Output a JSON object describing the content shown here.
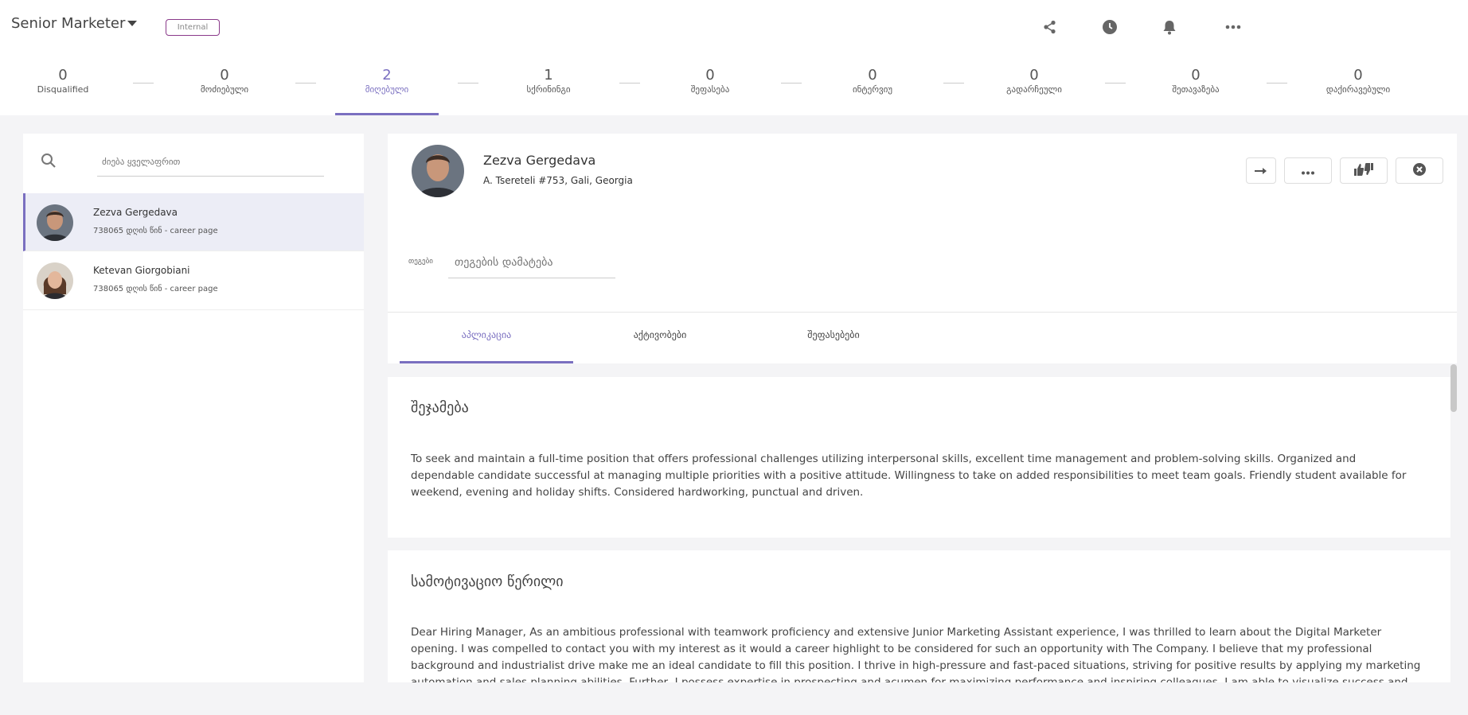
{
  "header": {
    "job_title": "Senior Marketer",
    "badge": "Internal",
    "icons": [
      "share-icon",
      "clock-icon",
      "bell-icon",
      "more-icon"
    ]
  },
  "stages": [
    {
      "count": "0",
      "label": "Disqualified"
    },
    {
      "count": "0",
      "label": "მოძიებული"
    },
    {
      "count": "2",
      "label": "მიღებული",
      "active": true
    },
    {
      "count": "1",
      "label": "სქრინინგი"
    },
    {
      "count": "0",
      "label": "შეფასება"
    },
    {
      "count": "0",
      "label": "ინტერვიუ"
    },
    {
      "count": "0",
      "label": "გადარჩეული"
    },
    {
      "count": "0",
      "label": "შეთავაზება"
    },
    {
      "count": "0",
      "label": "დაქირავებული"
    }
  ],
  "search": {
    "placeholder": "ძიება ყველაფრით"
  },
  "candidates": [
    {
      "name": "Zezva Gergedava",
      "meta": "738065 დღის წინ - career page"
    },
    {
      "name": "Ketevan Giorgobiani",
      "meta": "738065 დღის წინ - career page"
    }
  ],
  "profile": {
    "name": "Zezva Gergedava",
    "address": "A. Tsereteli #753, Gali, Georgia",
    "tags_label": "თეგები",
    "tags_placeholder": "თეგების დამატება"
  },
  "tabs": [
    "აპლიკაცია",
    "აქტივობები",
    "შეფასებები"
  ],
  "sections": {
    "summary_title": "შეჯამება",
    "summary_text": "To seek and maintain a full-time position that offers professional challenges utilizing interpersonal skills, excellent time management and problem-solving skills. Organized and dependable candidate successful at managing multiple priorities with a positive attitude. Willingness to take on added responsibilities to meet team goals. Friendly student available for weekend, evening and holiday shifts. Considered hardworking, punctual and driven.",
    "cover_title": "სამოტივაციო წერილი",
    "cover_text": "Dear Hiring Manager, As an ambitious professional with teamwork proficiency and extensive Junior Marketing Assistant experience, I was thrilled to learn about the Digital Marketer opening. I was compelled to contact you with my interest as it would a career highlight to be considered for such an opportunity with The Company. I believe that my professional background and industrialist drive make me an ideal candidate to fill this position. I thrive in high-pressure and fast-paced situations, striving for positive results by applying my marketing automation and sales planning abilities. Further, I possess expertise in prospecting and acumen for maximizing performance and inspiring colleagues. I am able to visualize success and identify unconventional yet highly effective strategies for achieving it."
  },
  "colors": {
    "accent": "#7a6fc0",
    "badge_border": "#8a3a8a",
    "background": "#f4f4f6"
  }
}
